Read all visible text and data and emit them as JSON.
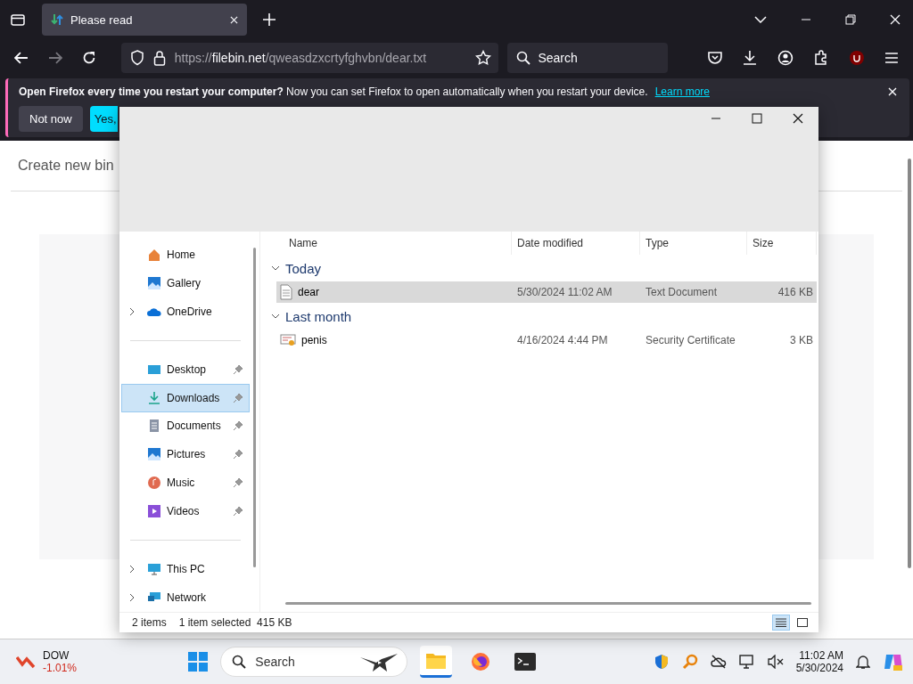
{
  "browser": {
    "tab_title": "Please read",
    "url": {
      "scheme": "https://",
      "host": "filebin.net",
      "path": "/qweasdzxcrtyfghvbn/dear.txt"
    },
    "search_placeholder": "Search",
    "notification": {
      "text": "**Open Firefox every time you restart your computer?** Now you can set Firefox to open automatically when you restart your device.",
      "link": "Learn more",
      "buttons": [
        "Not now",
        "Yes,"
      ]
    },
    "page": {
      "heading": "Create new bin"
    }
  },
  "explorer": {
    "nav_groups": [
      [
        {
          "label": "Home",
          "expandable": false,
          "pinned": false,
          "selected": false
        },
        {
          "label": "Gallery",
          "expandable": false,
          "pinned": false,
          "selected": false
        },
        {
          "label": "OneDrive",
          "expandable": true,
          "pinned": false,
          "selected": false
        }
      ],
      [
        {
          "label": "Desktop",
          "expandable": false,
          "pinned": true,
          "selected": false
        },
        {
          "label": "Downloads",
          "expandable": false,
          "pinned": true,
          "selected": true
        },
        {
          "label": "Documents",
          "expandable": false,
          "pinned": true,
          "selected": false
        },
        {
          "label": "Pictures",
          "expandable": false,
          "pinned": true,
          "selected": false
        },
        {
          "label": "Music",
          "expandable": false,
          "pinned": true,
          "selected": false
        },
        {
          "label": "Videos",
          "expandable": false,
          "pinned": true,
          "selected": false
        }
      ],
      [
        {
          "label": "This PC",
          "expandable": true,
          "pinned": false,
          "selected": false
        },
        {
          "label": "Network",
          "expandable": true,
          "pinned": false,
          "selected": false
        }
      ]
    ],
    "columns": [
      "Name",
      "Date modified",
      "Type",
      "Size"
    ],
    "groups": [
      {
        "label": "Today",
        "expanded": true,
        "files": [
          {
            "name": "dear",
            "date": "5/30/2024 11:02 AM",
            "type": "Text Document",
            "size": "416 KB",
            "selected": true
          }
        ]
      },
      {
        "label": "Last month",
        "expanded": true,
        "files": [
          {
            "name": "penis",
            "date": "4/16/2024 4:44 PM",
            "type": "Security Certificate",
            "size": "3 KB",
            "selected": false
          }
        ]
      }
    ],
    "status": {
      "count": "2 items",
      "selection": "1 item selected  415 KB"
    },
    "views": [
      {
        "kind": "details",
        "selected": true
      },
      {
        "kind": "tiles",
        "selected": false
      }
    ]
  },
  "taskbar": {
    "ticker": {
      "name": "DOW",
      "change": "-1.01%"
    },
    "search_placeholder": "Search",
    "time": "11:02 AM",
    "date": "5/30/2024"
  }
}
